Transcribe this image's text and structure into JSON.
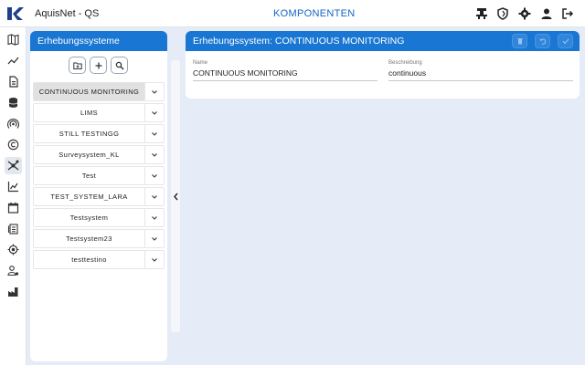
{
  "app": {
    "title": "AquisNet - QS",
    "nav_title": "KOMPONENTEN"
  },
  "top_icons": [
    "hub-icon",
    "shield-icon",
    "gear-icon",
    "user-icon",
    "logout-icon"
  ],
  "sidebar": {
    "items": [
      {
        "icon": "map-icon",
        "active": false
      },
      {
        "icon": "trend-icon",
        "active": false
      },
      {
        "icon": "document-icon",
        "active": false
      },
      {
        "icon": "database-icon",
        "active": false
      },
      {
        "icon": "signal-icon",
        "active": false
      },
      {
        "icon": "copyright-icon",
        "active": false
      },
      {
        "icon": "components-icon",
        "active": true
      },
      {
        "icon": "chart-icon",
        "active": false
      },
      {
        "icon": "calendar-icon",
        "active": false
      },
      {
        "icon": "report-icon",
        "active": false
      },
      {
        "icon": "location-icon",
        "active": false
      },
      {
        "icon": "user-settings-icon",
        "active": false
      },
      {
        "icon": "factory-icon",
        "active": false
      }
    ]
  },
  "left_panel": {
    "title": "Erhebungssysteme",
    "toolbar": [
      "folder-add-icon",
      "add-icon",
      "search-icon"
    ],
    "items": [
      {
        "label": "CONTINUOUS MONITORING",
        "selected": true
      },
      {
        "label": "LIMS",
        "selected": false
      },
      {
        "label": "STILL TESTINGG",
        "selected": false
      },
      {
        "label": "Surveysystem_KL",
        "selected": false
      },
      {
        "label": "Test",
        "selected": false
      },
      {
        "label": "TEST_SYSTEM_LARA",
        "selected": false
      },
      {
        "label": "Testsystem",
        "selected": false
      },
      {
        "label": "Testsystem23",
        "selected": false
      },
      {
        "label": "testtestino",
        "selected": false
      }
    ]
  },
  "detail": {
    "title": "Erhebungssystem: CONTINUOUS MONITORING",
    "actions": [
      "delete-icon",
      "undo-icon",
      "check-icon"
    ],
    "fields": {
      "name": {
        "label": "Name",
        "value": "CONTINUOUS MONITORING"
      },
      "description": {
        "label": "Beschreibung",
        "value": "continuous"
      }
    }
  }
}
